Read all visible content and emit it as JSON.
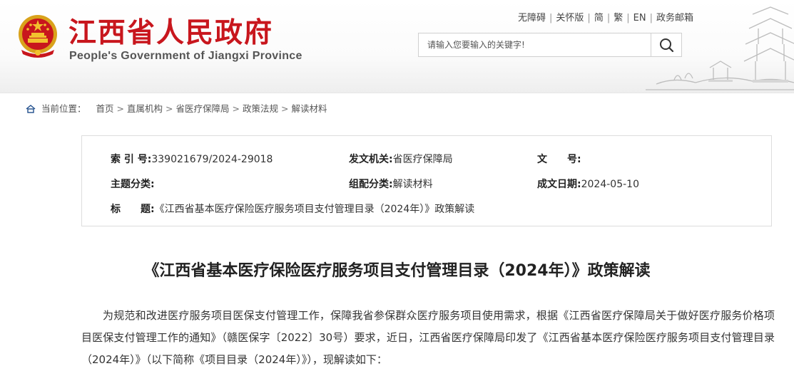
{
  "header": {
    "site_title": "江西省人民政府",
    "site_subtitle": "People's Government of Jiangxi Province",
    "top_links": [
      "无障碍",
      "关怀版",
      "简",
      "繁",
      "EN",
      "政务邮箱"
    ],
    "search_placeholder": "请输入您要输入的关键字!",
    "emblem_icon": "national-emblem-icon",
    "search_icon": "magnifier-icon",
    "brand_color": "#c8161d"
  },
  "breadcrumb": {
    "label": "当前位置：",
    "items": [
      "首页",
      "直属机构",
      "省医疗保障局",
      "政策法规",
      "解读材料"
    ],
    "separator": ">"
  },
  "info": {
    "index_no_label": "索 引 号:",
    "index_no": "339021679/2024-29018",
    "issuer_label": "发文机关:",
    "issuer": "省医疗保障局",
    "doc_no_label": "文　　号:",
    "doc_no": "",
    "topic_label": "主题分类:",
    "topic": "",
    "category_label": "组配分类:",
    "category": "解读材料",
    "date_label": "成文日期:",
    "date": "2024-05-10",
    "title_label": "标　　题:",
    "title": "《江西省基本医疗保险医疗服务项目支付管理目录（2024年）》政策解读"
  },
  "article": {
    "title": "《江西省基本医疗保险医疗服务项目支付管理目录（2024年）》政策解读",
    "paragraph": "为规范和改进医疗服务项目医保支付管理工作，保障我省参保群众医疗服务项目使用需求，根据《江西省医疗保障局关于做好医疗服务价格项目医保支付管理工作的通知》（赣医保字〔2022〕30号）要求，近日，江西省医疗保障局印发了《江西省基本医疗保险医疗服务项目支付管理目录（2024年）》（以下简称《项目目录（2024年）》），现解读如下："
  }
}
